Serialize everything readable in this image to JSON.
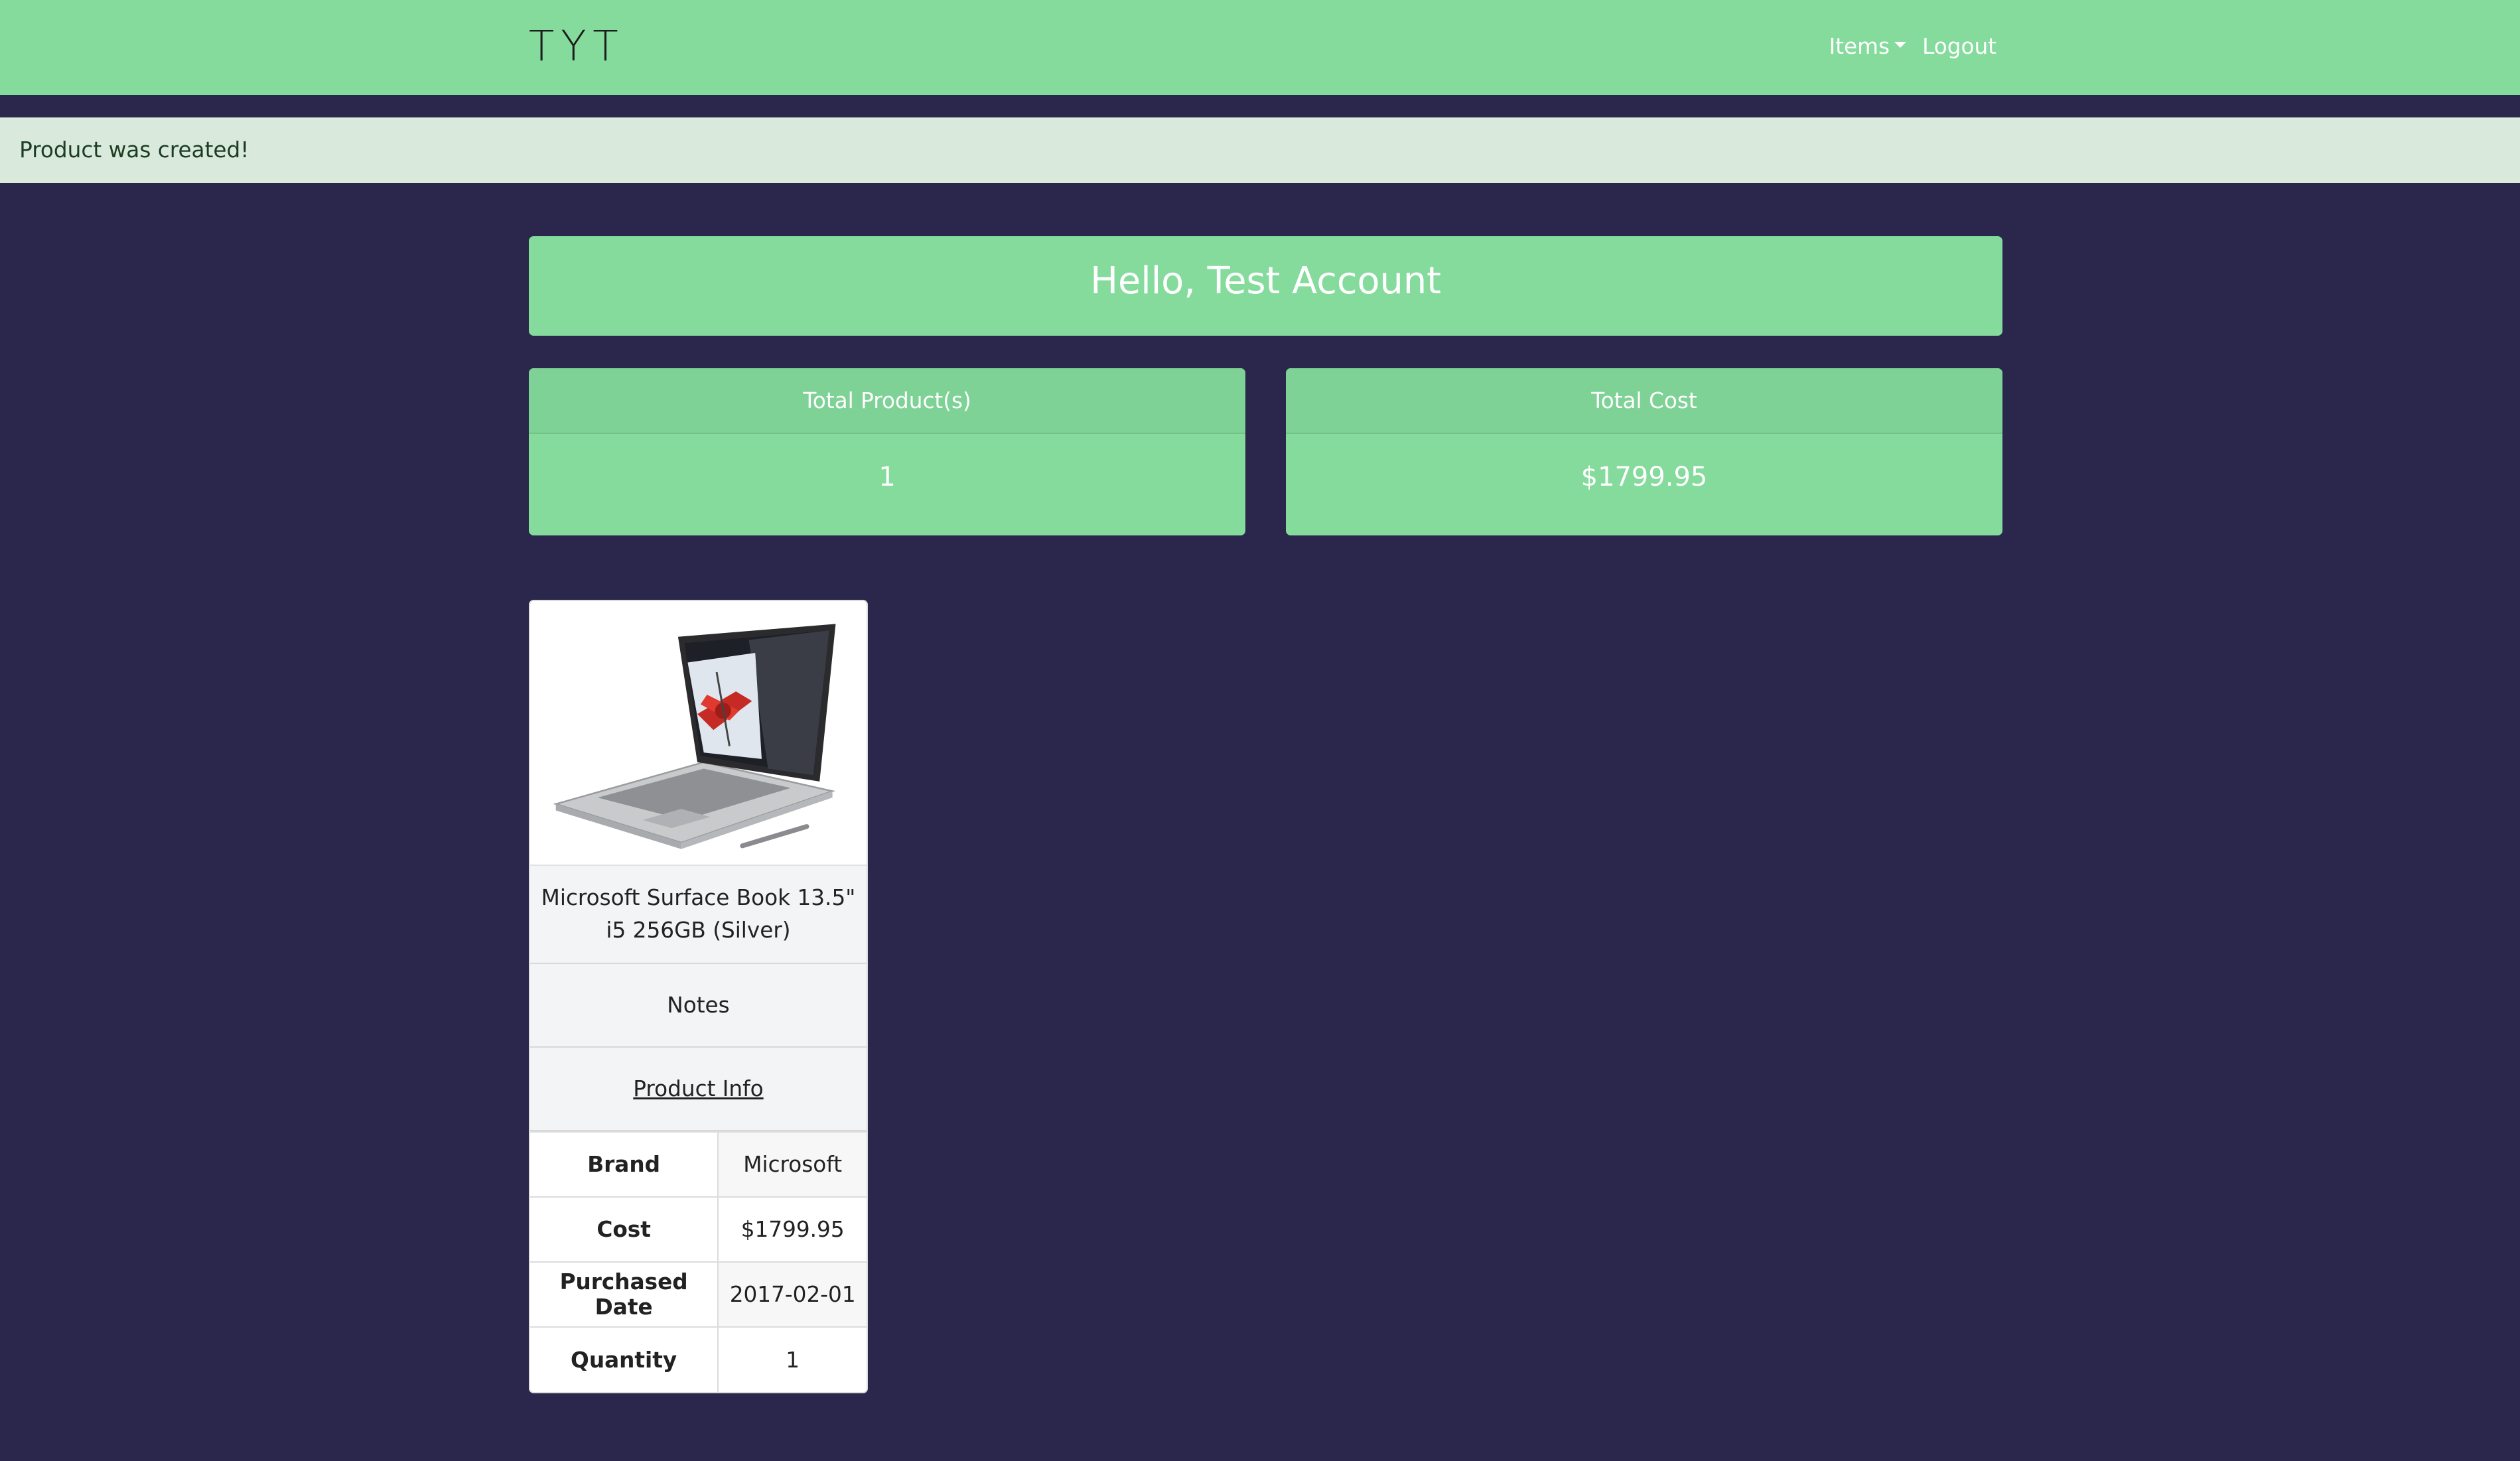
{
  "navbar": {
    "brand": "TYT",
    "items_label": "Items",
    "logout_label": "Logout"
  },
  "alert": {
    "message": "Product was created!"
  },
  "greeting": "Hello, Test Account",
  "stats": {
    "products": {
      "label": "Total Product(s)",
      "value": "1"
    },
    "cost": {
      "label": "Total Cost",
      "value": "$1799.95"
    }
  },
  "product": {
    "title_line1": "Microsoft Surface Book 13.5\"",
    "title_line2": "i5 256GB (Silver)",
    "notes_label": "Notes",
    "info_label": "Product Info",
    "image_icon": "laptop-image",
    "specs": [
      {
        "key": "Brand",
        "value": "Microsoft"
      },
      {
        "key": "Cost",
        "value": "$1799.95"
      },
      {
        "key": "Purchased Date",
        "value": "2017-02-01"
      },
      {
        "key": "Quantity",
        "value": "1"
      }
    ]
  },
  "colors": {
    "background": "#2a264c",
    "accent": "#84db9c",
    "alert_bg": "#d9eadc"
  }
}
